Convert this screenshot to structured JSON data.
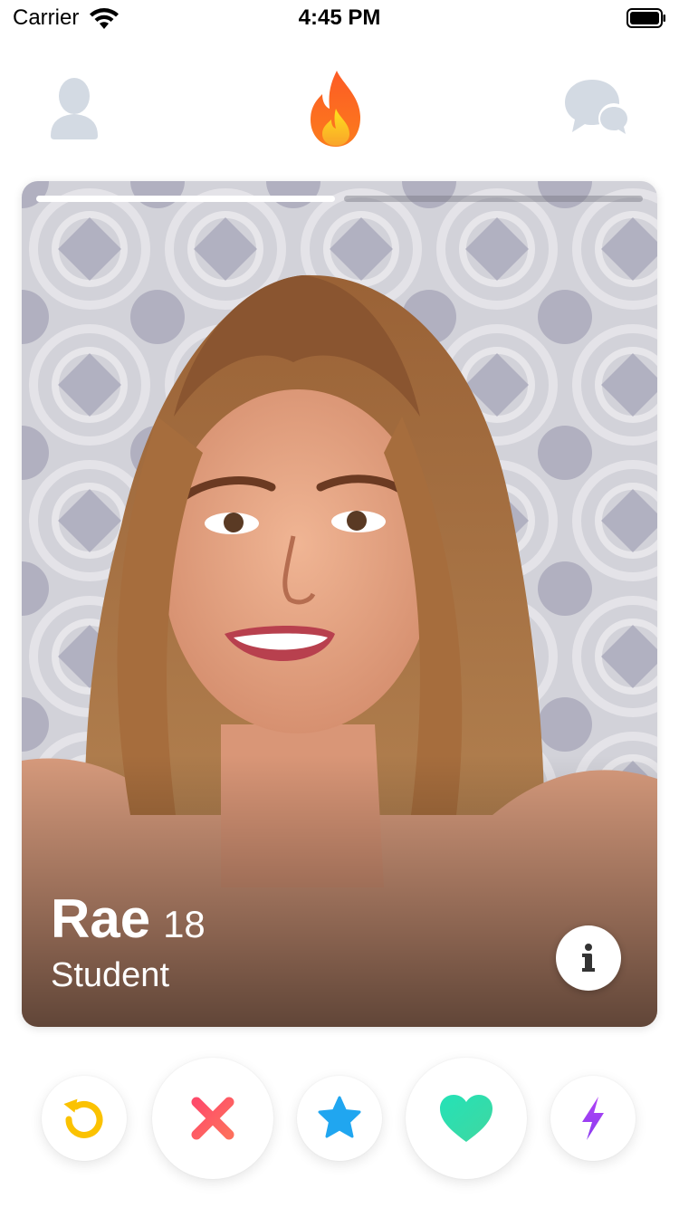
{
  "status_bar": {
    "carrier": "Carrier",
    "time": "4:45 PM"
  },
  "top_nav": {
    "icons": [
      "profile-icon",
      "flame-icon",
      "chat-icon"
    ],
    "active": "flame-icon",
    "inactive_color": "#d3dae3",
    "active_gradient": [
      "#fd5b25",
      "#f9a42a",
      "#ffe11c"
    ]
  },
  "card": {
    "name": "Rae",
    "age": "18",
    "occupation": "Student",
    "photo_count": 2,
    "current_photo": 1
  },
  "actions": {
    "rewind_color": "#fbc201",
    "nope_gradient": [
      "#fe4b6a",
      "#fd6f5d"
    ],
    "super_like_color": "#20a6f0",
    "like_gradient": [
      "#24e2b7",
      "#40d7a0"
    ],
    "boost_gradient": [
      "#b042f5",
      "#8b3cf0"
    ]
  }
}
